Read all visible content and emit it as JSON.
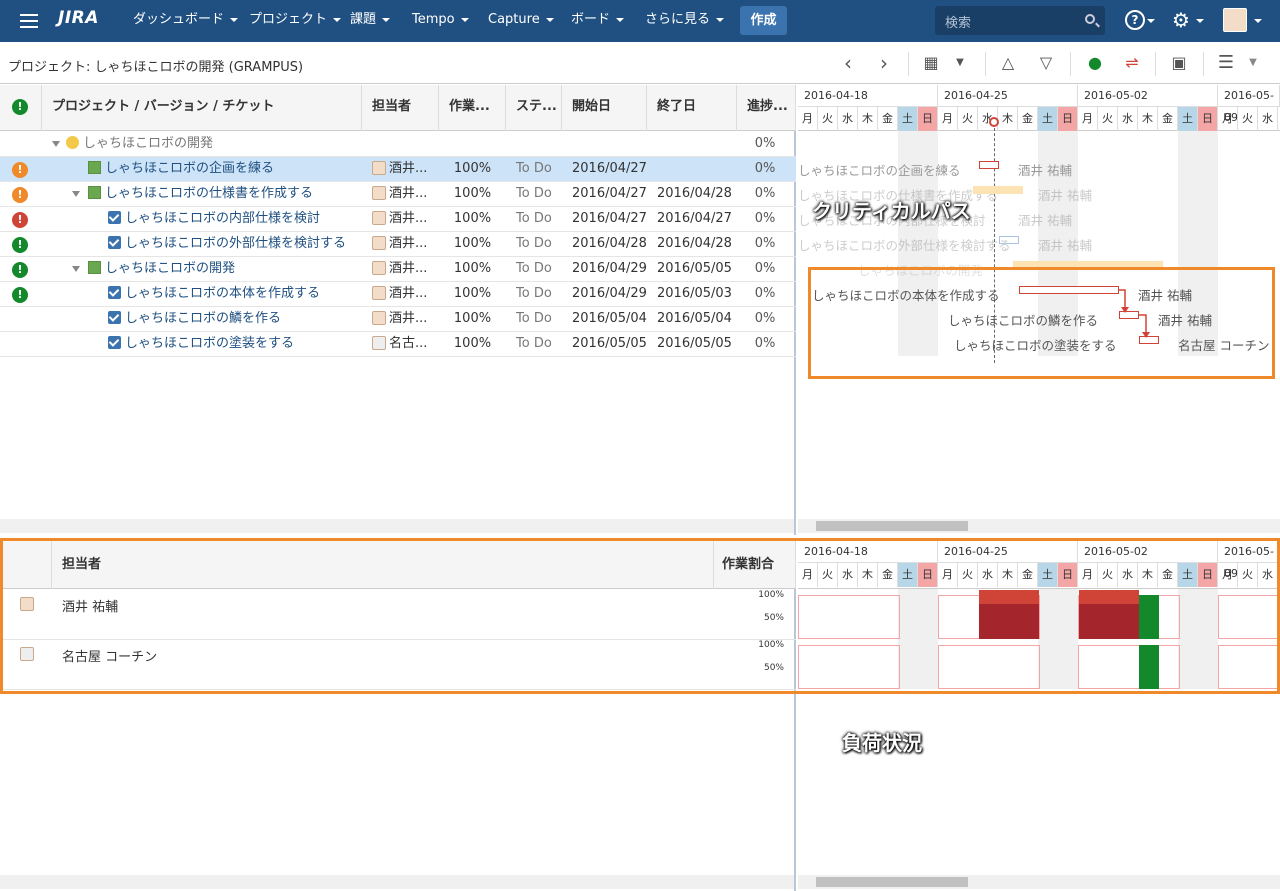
{
  "nav": {
    "logo": "JIRA",
    "items": [
      "ダッシュボード",
      "プロジェクト",
      "課題",
      "Tempo",
      "Capture",
      "ボード",
      "さらに見る"
    ],
    "create": "作成",
    "search_placeholder": "検索",
    "help_icon": "?"
  },
  "toolbar": {
    "project_title": "プロジェクト: しゃちほこロボの開発 (GRAMPUS)"
  },
  "grid": {
    "headers": {
      "status": "",
      "name": "プロジェクト / バージョン / チケット",
      "assignee": "担当者",
      "work": "作業...",
      "state": "ステ...",
      "start": "開始日",
      "end": "終了日",
      "progress": "進捗..."
    },
    "rows": [
      {
        "status": "",
        "name": "しゃちほこロボの開発",
        "assignee": "",
        "work": "",
        "state": "",
        "start": "",
        "end": "",
        "progress": "0%"
      },
      {
        "status": "!",
        "name": "しゃちほこロボの企画を練る",
        "assignee": "酒井...",
        "work": "100%",
        "state": "To Do",
        "start": "2016/04/27",
        "end": "",
        "progress": "0%"
      },
      {
        "status": "!",
        "name": "しゃちほこロボの仕様書を作成する",
        "assignee": "酒井...",
        "work": "100%",
        "state": "To Do",
        "start": "2016/04/27",
        "end": "2016/04/28",
        "progress": "0%"
      },
      {
        "status": "!",
        "name": "しゃちほこロボの内部仕様を検討",
        "assignee": "酒井...",
        "work": "100%",
        "state": "To Do",
        "start": "2016/04/27",
        "end": "2016/04/27",
        "progress": "0%"
      },
      {
        "status": "!",
        "name": "しゃちほこロボの外部仕様を検討する",
        "assignee": "酒井...",
        "work": "100%",
        "state": "To Do",
        "start": "2016/04/28",
        "end": "2016/04/28",
        "progress": "0%"
      },
      {
        "status": "!",
        "name": "しゃちほこロボの開発",
        "assignee": "酒井...",
        "work": "100%",
        "state": "To Do",
        "start": "2016/04/29",
        "end": "2016/05/05",
        "progress": "0%"
      },
      {
        "status": "!",
        "name": "しゃちほこロボの本体を作成する",
        "assignee": "酒井...",
        "work": "100%",
        "state": "To Do",
        "start": "2016/04/29",
        "end": "2016/05/03",
        "progress": "0%"
      },
      {
        "status": "",
        "name": "しゃちほこロボの鱗を作る",
        "assignee": "酒井...",
        "work": "100%",
        "state": "To Do",
        "start": "2016/05/04",
        "end": "2016/05/04",
        "progress": "0%"
      },
      {
        "status": "",
        "name": "しゃちほこロボの塗装をする",
        "assignee": "名古...",
        "work": "100%",
        "state": "To Do",
        "start": "2016/05/05",
        "end": "2016/05/05",
        "progress": "0%"
      }
    ]
  },
  "gantt": {
    "weeks": [
      "2016-04-18",
      "2016-04-25",
      "2016-05-02",
      "2016-05-09"
    ],
    "days": [
      "月",
      "火",
      "水",
      "木",
      "金",
      "土",
      "日",
      "月",
      "火",
      "水",
      "木",
      "金",
      "土",
      "日",
      "月",
      "火",
      "水",
      "木",
      "金",
      "土",
      "日",
      "月",
      "火",
      "水"
    ],
    "labels": [
      {
        "task": "しゃちほこロボの企画を練る",
        "who": "酒井 祐輔"
      },
      {
        "task": "しゃちほこロボの仕様書を作成する",
        "who": "酒井 祐輔"
      },
      {
        "task": "しゃちほこロボの内部仕様を検討",
        "who": "酒井 祐輔"
      },
      {
        "task": "しゃちほこロボの外部仕様を検討する",
        "who": "酒井 祐輔"
      },
      {
        "task": "しゃちほこロボの開発",
        "who": "酒井 祐輔"
      },
      {
        "task": "しゃちほこロボの本体を作成する",
        "who": "酒井 祐輔"
      },
      {
        "task": "しゃちほこロボの鱗を作る",
        "who": "酒井 祐輔"
      },
      {
        "task": "しゃちほこロボの塗装をする",
        "who": "名古屋 コーチン"
      }
    ],
    "critical_path_label": "クリティカルパス"
  },
  "resources": {
    "headers": {
      "assignee": "担当者",
      "ratio": "作業割合"
    },
    "rows": [
      {
        "name": "酒井 祐輔",
        "p100": "100%",
        "p50": "50%"
      },
      {
        "name": "名古屋 コーチン",
        "p100": "100%",
        "p50": "50%"
      }
    ],
    "load_label": "負荷状況"
  },
  "colors": {
    "nav_bg": "#205081",
    "critical": "#f0892a",
    "overload": "#a4262c",
    "ok_load": "#14892c"
  }
}
